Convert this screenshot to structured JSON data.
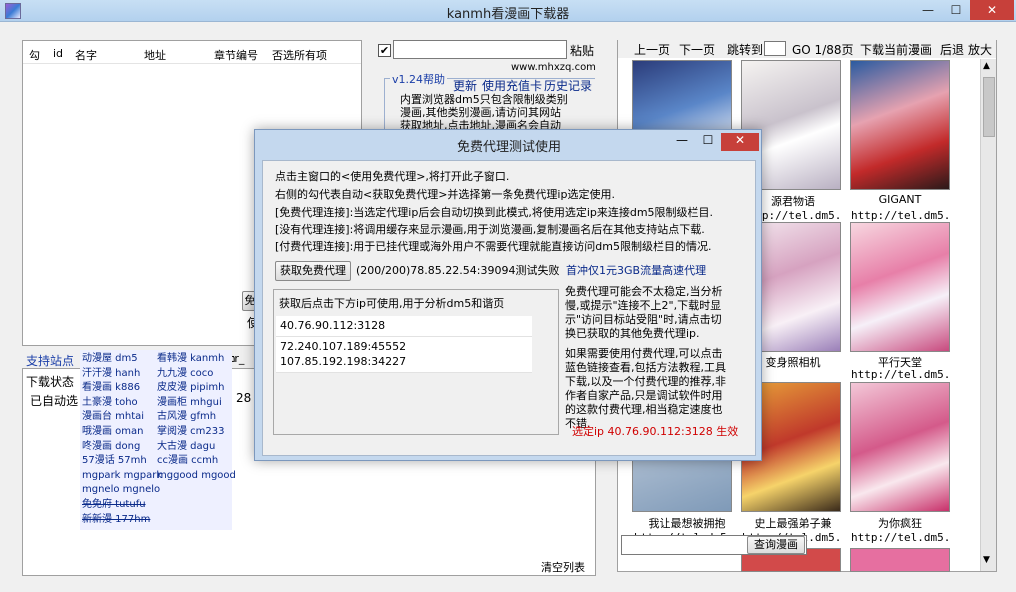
{
  "window": {
    "title": "kanmh看漫画下载器",
    "minimize": "—",
    "maximize": "☐",
    "close": "✕"
  },
  "chapter_table": {
    "headers": [
      "勾",
      "id",
      "名字",
      "地址",
      "章节编号",
      "否选所有项"
    ]
  },
  "top": {
    "url_value": "",
    "paste_label": "粘贴",
    "site_text": "www.mhxzq.com",
    "help_label": "v1.24帮助",
    "links": [
      "更新",
      "使用充值卡",
      "历史记录"
    ],
    "desc_lines": [
      "内置浏览器dm5只包含限制级类别",
      "漫画,其他类别漫画,请访问其网站",
      "获取地址,点击地址,漫画名会自动"
    ]
  },
  "left_mid": {
    "btn_partial": "免",
    "text_partial": "使"
  },
  "sites": {
    "label": "支持站点",
    "extra_label": "kanmh",
    "extra2": "tr_",
    "items": [
      "动漫屋 dm5",
      "看韩漫 kanmh",
      "汗汗漫 hanh",
      "九九漫 coco",
      "看漫画 k886",
      "皮皮漫 pipimh",
      "土豪漫 toho",
      "漫画柜 mhgui",
      "漫画台 mhtai",
      "古风漫 gfmh",
      "哦漫画 oman",
      "掌阅漫 cm233",
      "咚漫画 dong",
      "大古漫 dagu",
      "57漫话 57mh",
      "cc漫画 ccmh",
      "mgpark mgpark",
      "mggood mgood",
      "mgnelo mgnelo",
      "",
      "免免府 tutufu",
      "",
      "新新漫 177hm",
      ""
    ]
  },
  "download": {
    "header": "下载状态",
    "status": "已自动选",
    "count_partial": "28",
    "clear_label": "清空列表"
  },
  "nav": {
    "prev": "上一页",
    "next": "下一页",
    "jump": "跳转到",
    "go": "GO 1/88页",
    "download_current": "下载当前漫画",
    "back": "后退",
    "zoom": "放大"
  },
  "comics": [
    {
      "title": "",
      "url": ""
    },
    {
      "title": "源君物语",
      "url": "http://tel.dm5."
    },
    {
      "title": "GIGANT",
      "url": "http://tel.dm5."
    },
    {
      "title": "",
      "url": ""
    },
    {
      "title": "变身照相机",
      "url": ""
    },
    {
      "title": "平行天堂",
      "url": "http://tel.dm5."
    },
    {
      "title": "我让最想被拥抱",
      "url": "http://tel.dm5."
    },
    {
      "title": "史上最强弟子兼",
      "url": "http://tel.dm5."
    },
    {
      "title": "为你疯狂",
      "url": "http://tel.dm5."
    }
  ],
  "search_label": "查询漫画",
  "dialog": {
    "title": "免费代理测试使用",
    "min": "—",
    "max": "☐",
    "close": "✕",
    "lines": [
      "点击主窗口的<使用免费代理>,将打开此子窗口.",
      "右侧的勾代表自动<获取免费代理>并选择第一条免费代理ip选定使用.",
      "[免费代理连接]:当选定代理ip后会自动切换到此模式,将使用选定ip来连接dm5限制级栏目.",
      "[没有代理连接]:将调用缓存来显示漫画,用于浏览漫画,复制漫画名后在其他支持站点下载.",
      "[付费代理连接]:用于已挂代理或海外用户不需要代理就能直接访问dm5限制级栏目的情况."
    ],
    "get_button": "获取免费代理",
    "test_status": "(200/200)78.85.22.54:39094测试失败",
    "promo_link": "首冲仅1元3GB流量高速代理",
    "list_header": "获取后点击下方ip可使用,用于分析dm5和谐页",
    "ips": [
      "40.76.90.112:3128",
      "72.240.107.189:45552",
      "107.85.192.198:34227"
    ],
    "note1": [
      "免费代理可能会不太稳定,当分析",
      "慢,或提示\"连接不上2\",下载时显",
      "示\"访问目标站受阻\"时,请点击切",
      "换已获取的其他免费代理ip."
    ],
    "note2": [
      "如果需要使用付费代理,可以点击",
      "蓝色链接查看,包括方法教程,工具",
      "下载,以及一个付费代理的推荐,非",
      "作者自家产品,只是调试软件时用",
      "的这款付费代理,相当稳定速度也",
      "不错."
    ],
    "selected": "选定ip 40.76.90.112:3128 生效"
  }
}
